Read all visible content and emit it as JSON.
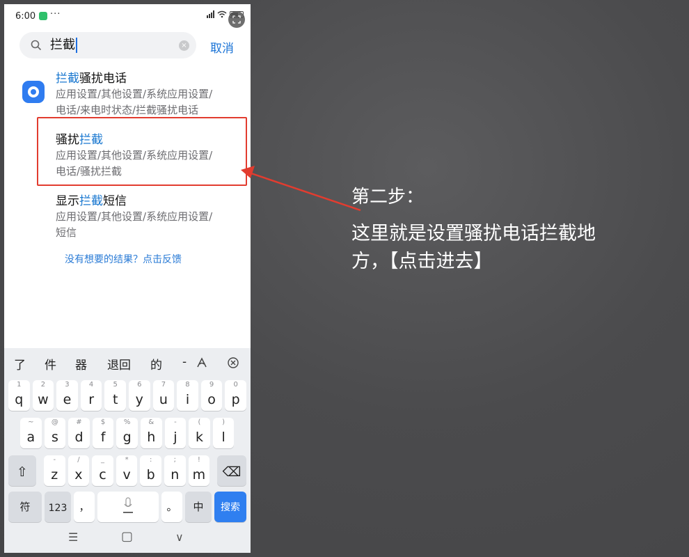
{
  "status_bar": {
    "time": "6:00",
    "more": "···"
  },
  "search": {
    "query": "拦截",
    "cancel_label": "取消",
    "clear_glyph": "×"
  },
  "results": [
    {
      "title_highlight": "拦截",
      "title_rest": "骚扰电话",
      "path_line1": "应用设置/其他设置/系统应用设置/",
      "path_line2": "电话/来电时状态/拦截骚扰电话"
    },
    {
      "title_prefix": "骚扰",
      "title_highlight": "拦截",
      "path_line1": "应用设置/其他设置/系统应用设置/",
      "path_line2": "电话/骚扰拦截"
    },
    {
      "title_prefix": "显示",
      "title_highlight": "拦截",
      "title_rest": "短信",
      "path_line1": "应用设置/其他设置/系统应用设置/",
      "path_line2": "短信"
    }
  ],
  "feedback": "没有想要的结果？点击反馈",
  "keyboard": {
    "candidates": [
      "了",
      "件",
      "器",
      "退回",
      "的",
      "-"
    ],
    "row1": [
      {
        "k": "q",
        "s": "1"
      },
      {
        "k": "w",
        "s": "2"
      },
      {
        "k": "e",
        "s": "3"
      },
      {
        "k": "r",
        "s": "4"
      },
      {
        "k": "t",
        "s": "5"
      },
      {
        "k": "y",
        "s": "6"
      },
      {
        "k": "u",
        "s": "7"
      },
      {
        "k": "i",
        "s": "8"
      },
      {
        "k": "o",
        "s": "9"
      },
      {
        "k": "p",
        "s": "0"
      }
    ],
    "row2": [
      {
        "k": "a",
        "s": "~"
      },
      {
        "k": "s",
        "s": "@"
      },
      {
        "k": "d",
        "s": "#"
      },
      {
        "k": "f",
        "s": "$"
      },
      {
        "k": "g",
        "s": "%"
      },
      {
        "k": "h",
        "s": "&"
      },
      {
        "k": "j",
        "s": "-"
      },
      {
        "k": "k",
        "s": "("
      },
      {
        "k": "l",
        "s": ")"
      }
    ],
    "row3": [
      {
        "k": "z",
        "s": "-"
      },
      {
        "k": "x",
        "s": "/"
      },
      {
        "k": "c",
        "s": "_"
      },
      {
        "k": "v",
        "s": "*"
      },
      {
        "k": "b",
        "s": ":"
      },
      {
        "k": "n",
        "s": ";"
      },
      {
        "k": "m",
        "s": "!"
      }
    ],
    "symbols_label": "符",
    "numbers_label": "123",
    "comma_label": "，",
    "period_label": "。",
    "lang_label": "中",
    "search_label": "搜索",
    "shift_glyph": "⇧",
    "backspace_glyph": "⌫"
  },
  "nav": {
    "menu": "☰",
    "home": "▢",
    "back": "∨"
  },
  "annotation": {
    "step": "第二步：",
    "body": "这里就是设置骚扰电话拦截地方，【点击进去】"
  },
  "colors": {
    "highlight": "#1a78d0",
    "box_red": "#e23c2f",
    "accent_blue": "#2f7ff0"
  }
}
